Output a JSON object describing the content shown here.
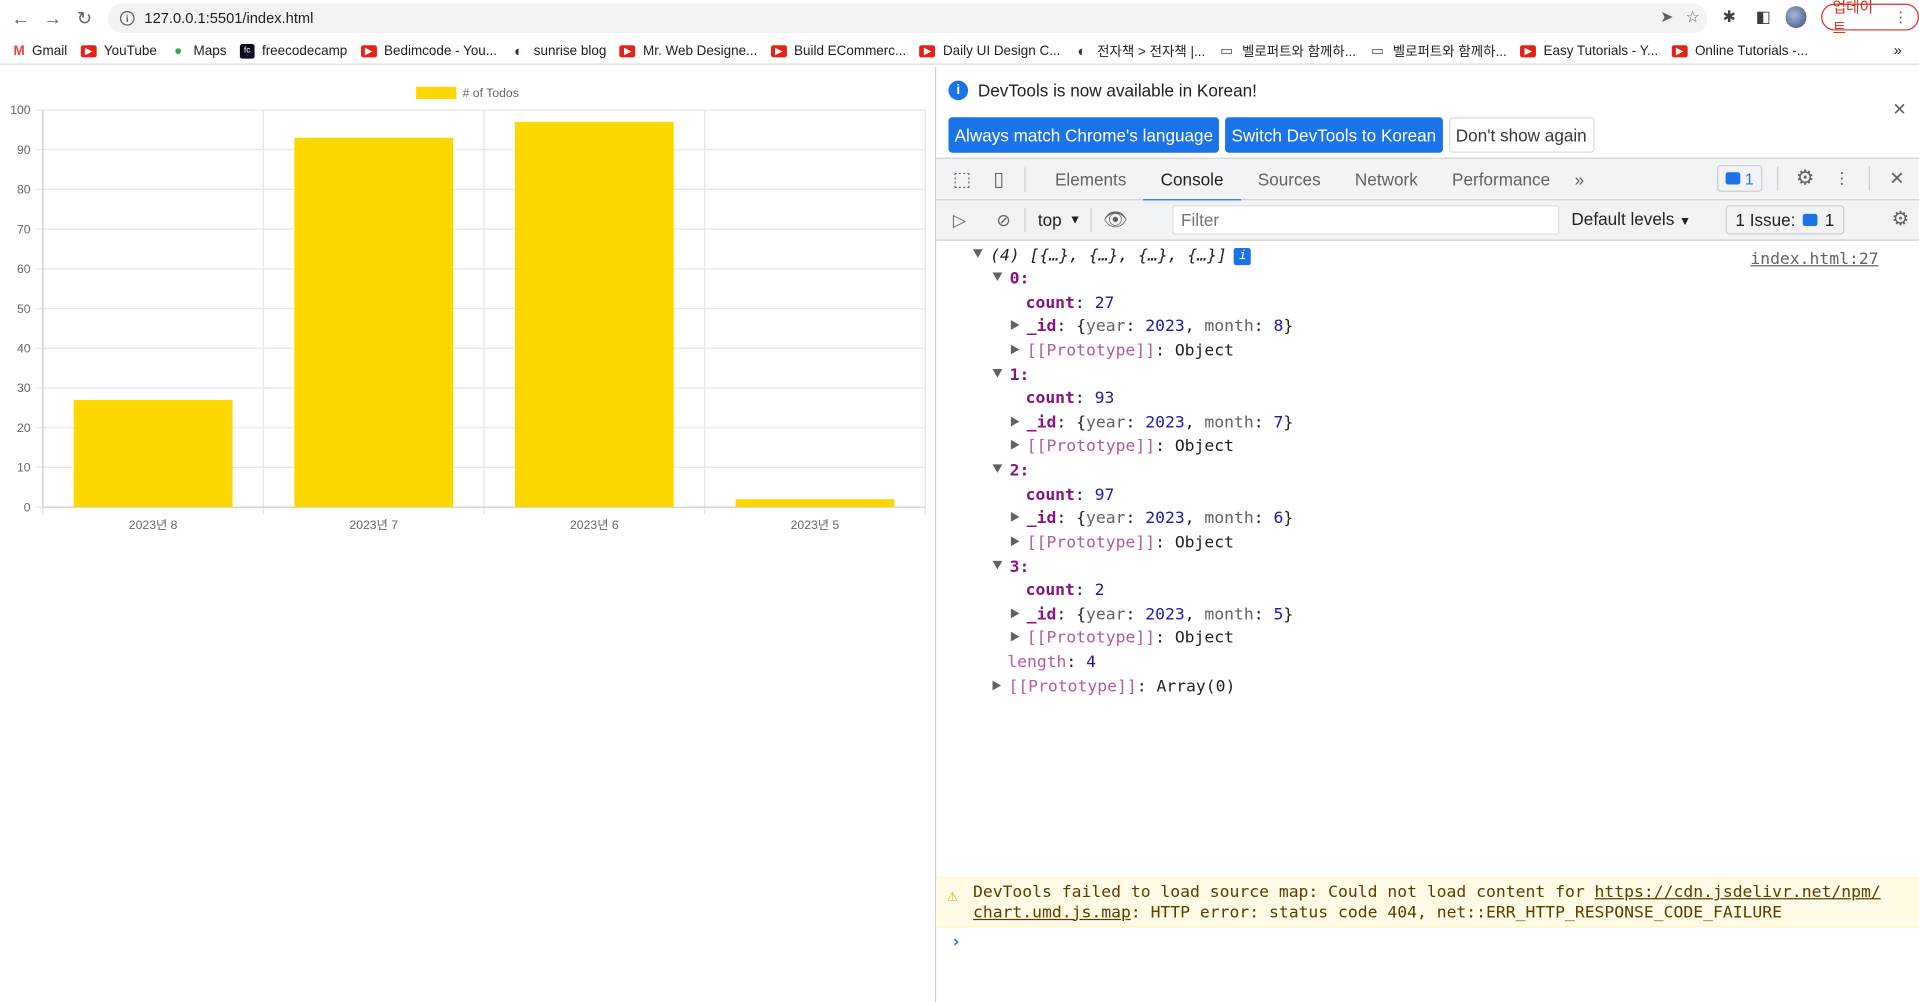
{
  "browser": {
    "url": "127.0.0.1:5501/index.html",
    "update_label": "업데이트",
    "bookmarks": [
      {
        "label": "Gmail",
        "icon": "gmail-icon"
      },
      {
        "label": "YouTube",
        "icon": "youtube-icon"
      },
      {
        "label": "Maps",
        "icon": "maps-icon"
      },
      {
        "label": "freecodecamp",
        "icon": "freecodecamp-icon"
      },
      {
        "label": "Bedimcode - You...",
        "icon": "youtube-icon"
      },
      {
        "label": "sunrise blog",
        "icon": "globe-icon"
      },
      {
        "label": "Mr. Web Designe...",
        "icon": "youtube-icon"
      },
      {
        "label": "Build ECommerc...",
        "icon": "youtube-icon"
      },
      {
        "label": "Daily UI Design C...",
        "icon": "youtube-icon"
      },
      {
        "label": "전자책 > 전자책 |...",
        "icon": "globe-icon"
      },
      {
        "label": "벨로퍼트와 함께하...",
        "icon": "book-icon"
      },
      {
        "label": "벨로퍼트와 함께하...",
        "icon": "book-icon"
      },
      {
        "label": "Easy Tutorials - Y...",
        "icon": "youtube-icon"
      },
      {
        "label": "Online Tutorials -...",
        "icon": "youtube-icon"
      }
    ]
  },
  "chart_data": {
    "type": "bar",
    "categories": [
      "2023년 8",
      "2023년 7",
      "2023년 6",
      "2023년 5"
    ],
    "series": [
      {
        "name": "# of Todos",
        "values": [
          27,
          93,
          97,
          2
        ],
        "color": "#FFD700"
      }
    ],
    "ylim": [
      0,
      100
    ],
    "yticks": [
      "0",
      "10",
      "20",
      "30",
      "40",
      "50",
      "60",
      "70",
      "80",
      "90",
      "100"
    ],
    "legend": "top"
  },
  "devtools": {
    "banner": {
      "message": "DevTools is now available in Korean!",
      "btn_match": "Always match Chrome's language",
      "btn_switch": "Switch DevTools to Korean",
      "btn_dont": "Don't show again"
    },
    "tabs": [
      "Elements",
      "Console",
      "Sources",
      "Network",
      "Performance"
    ],
    "active_tab": "Console",
    "msg_count": "1",
    "toolbar": {
      "context": "top",
      "filter_placeholder": "Filter",
      "levels": "Default levels",
      "issues": "1 Issue:",
      "issues_count": "1"
    },
    "console": {
      "summary": "(4) [{…}, {…}, {…}, {…}]",
      "source": "index.html:27",
      "items": [
        {
          "idx": "0",
          "count": "27",
          "year": "2023",
          "month": "8"
        },
        {
          "idx": "1",
          "count": "93",
          "year": "2023",
          "month": "7"
        },
        {
          "idx": "2",
          "count": "97",
          "year": "2023",
          "month": "6"
        },
        {
          "idx": "3",
          "count": "2",
          "year": "2023",
          "month": "5"
        }
      ],
      "proto_obj": "Object",
      "length": "4",
      "proto_arr": "Array(0)",
      "warning_prefix": "DevTools failed to load source map: Could not load content for ",
      "warning_link1": "https://cdn.jsdelivr.net/npm/",
      "warning_link2": "chart.umd.js.map",
      "warning_suffix": ": HTTP error: status code 404, net::ERR_HTTP_RESPONSE_CODE_FAILURE"
    }
  }
}
